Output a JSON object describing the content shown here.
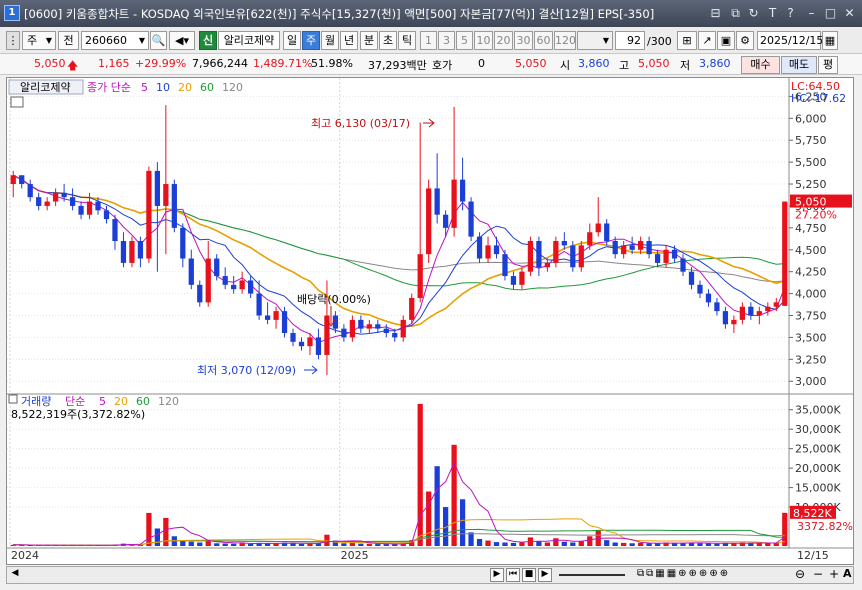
{
  "window": {
    "badge": "1",
    "title": "[0600] 키움종합차트 - KOSDAQ 외국인보유[622(천)] 주식수[15,327(천)] 액면[500] 자본금[77(억)] 결산[12월] EPS[-350]",
    "controls": [
      "⊟",
      "⧉",
      "↻",
      "T",
      "?",
      "–",
      "□",
      "✕"
    ]
  },
  "toolbar": {
    "market": "주",
    "prefix": "전",
    "code": "260660",
    "badge": "신",
    "stock_name": "알리코제약",
    "periods": [
      "일",
      "주",
      "월",
      "년",
      "분",
      "초",
      "틱"
    ],
    "selected_period": "주",
    "intervals": [
      "1",
      "3",
      "5",
      "10",
      "20",
      "30",
      "60",
      "120"
    ],
    "count": "92",
    "count_total": "/300",
    "date": "2025/12/15"
  },
  "quote": {
    "price": "5,050",
    "change": "1,165",
    "change_pct": "+29.99%",
    "volume": "7,966,244",
    "volume_pct": "1,489.71%",
    "rate": "51.98%",
    "amount": "37,293백만",
    "hoga_label": "호가",
    "hoga_value": "0",
    "hoga_price": "5,050",
    "open_label": "시",
    "open": "3,860",
    "high_label": "고",
    "high": "5,050",
    "low_label": "저",
    "low": "3,860",
    "buy_label": "매수",
    "sell_label": "매도",
    "eval_label": "평"
  },
  "price_panel": {
    "stock_name": "알리코제약",
    "legend_prefix": "종가 단순",
    "ma": [
      {
        "period": "5",
        "color": "#c010c0"
      },
      {
        "period": "10",
        "color": "#1b3fd6"
      },
      {
        "period": "20",
        "color": "#e8a000"
      },
      {
        "period": "60",
        "color": "#1f9a3a"
      },
      {
        "period": "120",
        "color": "#888888"
      }
    ],
    "lc_label": "LC:64.50",
    "hc_label": "HC:-17.62",
    "current_price_tag": "5,050",
    "current_pct_tag": "27.20%",
    "high_note": "최고 6,130 (03/17)",
    "low_note": "최저 3,070 (12/09)",
    "dividend_note": "배당락(0.00%)",
    "y_ticks": [
      "6,250",
      "6,000",
      "5,750",
      "5,500",
      "5,250",
      "5,000",
      "4,750",
      "4,500",
      "4,250",
      "4,000",
      "3,750",
      "3,500",
      "3,250",
      "3,000"
    ]
  },
  "volume_panel": {
    "label": "거래량",
    "legend_prefix": "단순",
    "ma": [
      {
        "period": "5",
        "color": "#c010c0"
      },
      {
        "period": "20",
        "color": "#e8a000"
      },
      {
        "period": "60",
        "color": "#1f9a3a"
      },
      {
        "period": "120",
        "color": "#888888"
      }
    ],
    "summary": "8,522,319주(3,372.82%)",
    "current_tag": "8,522K",
    "current_pct_tag": "3372.82%",
    "y_ticks": [
      "35,000K",
      "30,000K",
      "25,000K",
      "20,000K",
      "15,000K",
      "10,000K"
    ]
  },
  "x_axis": {
    "labels": [
      "2024",
      "2025"
    ],
    "end_label": "12/15"
  },
  "colors": {
    "up": "#e8111b",
    "down": "#1b3fd6",
    "ma5": "#c010c0",
    "ma10": "#1b3fd6",
    "ma20": "#e8a000",
    "ma60": "#1f9a3a",
    "ma120": "#888888"
  },
  "chart_data": {
    "type": "candlestick",
    "unit": "KRW",
    "interval": "weekly",
    "candles": [
      [
        5250,
        5400,
        5100,
        5350
      ],
      [
        5350,
        5350,
        5200,
        5250
      ],
      [
        5250,
        5300,
        5050,
        5100
      ],
      [
        5100,
        5150,
        4950,
        5000
      ],
      [
        5000,
        5100,
        4950,
        5050
      ],
      [
        5050,
        5200,
        5000,
        5150
      ],
      [
        5150,
        5250,
        5050,
        5100
      ],
      [
        5100,
        5200,
        4950,
        5000
      ],
      [
        5000,
        5050,
        4850,
        4900
      ],
      [
        4900,
        5150,
        4850,
        5050
      ],
      [
        5050,
        5100,
        4900,
        4950
      ],
      [
        4950,
        5000,
        4800,
        4850
      ],
      [
        4850,
        4900,
        4500,
        4600
      ],
      [
        4600,
        4700,
        4300,
        4350
      ],
      [
        4350,
        4650,
        4300,
        4600
      ],
      [
        4600,
        4650,
        4300,
        4400
      ],
      [
        4400,
        5450,
        4350,
        5400
      ],
      [
        5400,
        5500,
        4250,
        5000
      ],
      [
        5000,
        6150,
        4450,
        5250
      ],
      [
        5250,
        5300,
        4700,
        4750
      ],
      [
        4750,
        4800,
        4300,
        4400
      ],
      [
        4400,
        4500,
        4050,
        4100
      ],
      [
        4100,
        4150,
        3850,
        3900
      ],
      [
        3900,
        4600,
        3850,
        4400
      ],
      [
        4400,
        4450,
        4150,
        4200
      ],
      [
        4200,
        4300,
        4050,
        4100
      ],
      [
        4100,
        4200,
        4000,
        4050
      ],
      [
        4050,
        4250,
        4000,
        4150
      ],
      [
        4150,
        4200,
        3950,
        4000
      ],
      [
        4000,
        4150,
        3700,
        3750
      ],
      [
        3750,
        3900,
        3650,
        3700
      ],
      [
        3700,
        3850,
        3600,
        3800
      ],
      [
        3800,
        3850,
        3500,
        3550
      ],
      [
        3550,
        3600,
        3400,
        3450
      ],
      [
        3450,
        3500,
        3350,
        3400
      ],
      [
        3400,
        3550,
        3300,
        3500
      ],
      [
        3500,
        3600,
        3250,
        3300
      ],
      [
        3300,
        4150,
        3070,
        3750
      ],
      [
        3750,
        3800,
        3550,
        3600
      ],
      [
        3600,
        3650,
        3450,
        3500
      ],
      [
        3500,
        3750,
        3450,
        3700
      ],
      [
        3700,
        3750,
        3550,
        3600
      ],
      [
        3600,
        3700,
        3550,
        3650
      ],
      [
        3650,
        3700,
        3550,
        3600
      ],
      [
        3600,
        3650,
        3500,
        3550
      ],
      [
        3550,
        3600,
        3450,
        3500
      ],
      [
        3500,
        3750,
        3450,
        3700
      ],
      [
        3700,
        4000,
        3650,
        3950
      ],
      [
        3950,
        5950,
        3900,
        4450
      ],
      [
        4450,
        5300,
        4350,
        5200
      ],
      [
        5200,
        5600,
        4800,
        4900
      ],
      [
        4900,
        4950,
        4650,
        4750
      ],
      [
        4750,
        6130,
        4650,
        5300
      ],
      [
        5300,
        5550,
        4950,
        5050
      ],
      [
        5050,
        5100,
        4600,
        4650
      ],
      [
        4650,
        4700,
        4350,
        4400
      ],
      [
        4400,
        4650,
        4350,
        4550
      ],
      [
        4550,
        4650,
        4400,
        4450
      ],
      [
        4450,
        4500,
        4150,
        4200
      ],
      [
        4200,
        4250,
        4050,
        4100
      ],
      [
        4100,
        4300,
        4050,
        4250
      ],
      [
        4250,
        4650,
        4200,
        4600
      ],
      [
        4600,
        4650,
        4200,
        4300
      ],
      [
        4300,
        4400,
        4250,
        4350
      ],
      [
        4350,
        4650,
        4300,
        4600
      ],
      [
        4600,
        4700,
        4500,
        4550
      ],
      [
        4550,
        4600,
        4250,
        4300
      ],
      [
        4300,
        4600,
        4250,
        4550
      ],
      [
        4550,
        4800,
        4500,
        4700
      ],
      [
        4700,
        5100,
        4650,
        4800
      ],
      [
        4800,
        4850,
        4550,
        4600
      ],
      [
        4600,
        4650,
        4400,
        4450
      ],
      [
        4450,
        4600,
        4400,
        4550
      ],
      [
        4550,
        4650,
        4450,
        4500
      ],
      [
        4500,
        4650,
        4450,
        4600
      ],
      [
        4600,
        4650,
        4400,
        4450
      ],
      [
        4450,
        4500,
        4300,
        4350
      ],
      [
        4350,
        4550,
        4300,
        4500
      ],
      [
        4500,
        4550,
        4350,
        4400
      ],
      [
        4400,
        4450,
        4200,
        4250
      ],
      [
        4250,
        4300,
        4050,
        4100
      ],
      [
        4100,
        4150,
        3950,
        4000
      ],
      [
        4000,
        4050,
        3850,
        3900
      ],
      [
        3900,
        3950,
        3750,
        3800
      ],
      [
        3800,
        3850,
        3600,
        3650
      ],
      [
        3650,
        3750,
        3550,
        3700
      ],
      [
        3700,
        3900,
        3650,
        3850
      ],
      [
        3850,
        3900,
        3700,
        3750
      ],
      [
        3750,
        3850,
        3650,
        3800
      ],
      [
        3800,
        3900,
        3750,
        3850
      ],
      [
        3850,
        3950,
        3800,
        3900
      ],
      [
        3860,
        5050,
        3860,
        5050
      ]
    ],
    "volume_k": [
      300,
      250,
      200,
      180,
      220,
      260,
      200,
      180,
      200,
      240,
      200,
      180,
      400,
      600,
      500,
      450,
      8500,
      4500,
      7200,
      2500,
      1400,
      1100,
      900,
      1300,
      700,
      650,
      600,
      700,
      550,
      800,
      700,
      650,
      900,
      650,
      550,
      600,
      700,
      2900,
      1400,
      700,
      800,
      600,
      550,
      500,
      500,
      450,
      700,
      1500,
      36500,
      14000,
      20500,
      10000,
      26000,
      12000,
      3500,
      1800,
      1400,
      1000,
      900,
      800,
      900,
      2200,
      1300,
      900,
      2000,
      1100,
      900,
      1200,
      2500,
      4000,
      1500,
      900,
      800,
      700,
      800,
      700,
      650,
      900,
      700,
      800,
      900,
      700,
      650,
      600,
      800,
      700,
      900,
      750,
      700,
      800,
      800,
      8522
    ]
  }
}
